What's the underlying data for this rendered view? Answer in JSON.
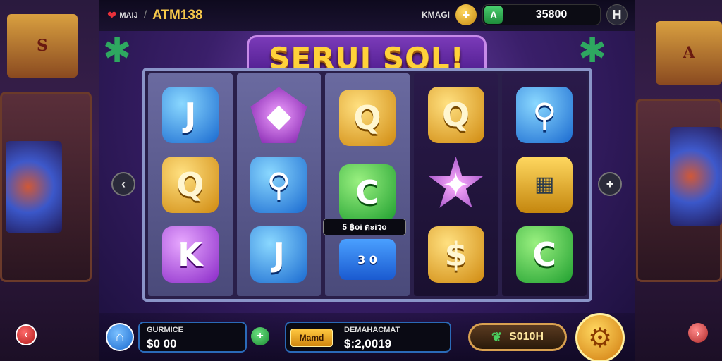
{
  "colors": {
    "accent_gold": "#ffd23a",
    "panel_blue": "#2a6ab8",
    "balance_green": "#1e8a3a"
  },
  "topbar": {
    "brand": "MAIJ",
    "separator": "/",
    "title": "ATM138",
    "coins_label": "KMAGI",
    "balance": "35800",
    "coin_icon_glyph": "A"
  },
  "logo": {
    "text": "SERUI SOL!"
  },
  "reels": [
    {
      "symbols": [
        {
          "glyph": "J",
          "icon": "blue-letter-j"
        },
        {
          "glyph": "Q",
          "icon": "gold-letter-q"
        },
        {
          "glyph": "K",
          "icon": "purple-letter-k"
        }
      ]
    },
    {
      "symbols": [
        {
          "glyph": "◆",
          "icon": "purple-gem"
        },
        {
          "glyph": "⚲",
          "icon": "blue-ring"
        },
        {
          "glyph": "J",
          "icon": "blue-letter-j"
        }
      ]
    },
    {
      "symbols": [
        {
          "glyph": "Q",
          "icon": "gold-letter-q"
        },
        {
          "glyph": "C",
          "icon": "green-letter-c"
        },
        {
          "glyph": "3 0",
          "icon": "blue-box"
        }
      ]
    },
    {
      "symbols": [
        {
          "glyph": "Q",
          "icon": "gold-letter-q"
        },
        {
          "glyph": "✦",
          "icon": "purple-star"
        },
        {
          "glyph": "$",
          "icon": "gold-dollar"
        }
      ]
    },
    {
      "symbols": [
        {
          "glyph": "⚲",
          "icon": "blue-ring"
        },
        {
          "glyph": "▦",
          "icon": "gold-machine"
        },
        {
          "glyph": "C",
          "icon": "green-letter-c"
        }
      ]
    }
  ],
  "win_tag": "5 ฿oi ด‌ะi‌วo",
  "bottom": {
    "balance_label": "GURMICE",
    "balance_value": "$0    00",
    "menu_label": "Mamd",
    "total_label": "DEMAHACMAT",
    "total_value": "$:2,0019",
    "spin_value": "S010H"
  }
}
